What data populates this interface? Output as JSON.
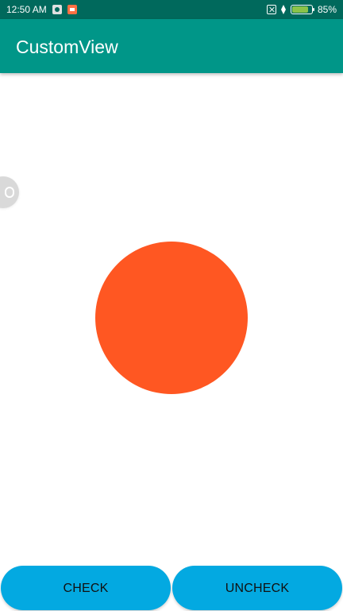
{
  "status_bar": {
    "time": "12:50 AM",
    "battery_percent": "85%",
    "battery_level": 0.85,
    "colors": {
      "background": "#00695c",
      "battery_fill": "#8bc34a"
    }
  },
  "app_bar": {
    "title": "CustomView",
    "background_color": "#009688"
  },
  "main": {
    "circle_color": "#ff5722",
    "side_helper_icon": "robot-icon"
  },
  "buttons": {
    "check_label": "CHECK",
    "uncheck_label": "UNCHECK",
    "button_color": "#03a9e1"
  }
}
